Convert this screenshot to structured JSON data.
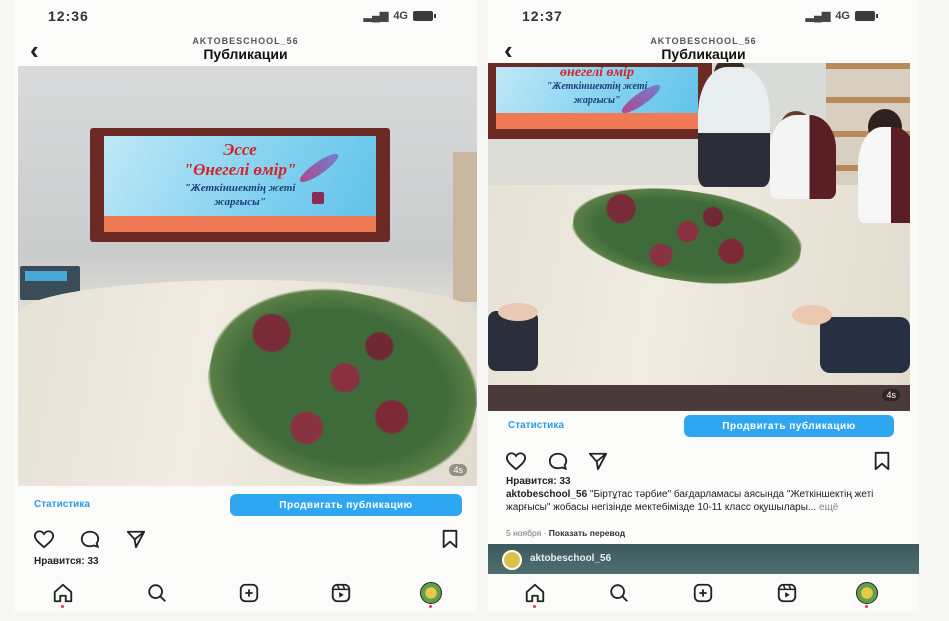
{
  "left": {
    "status": {
      "time": "12:36",
      "signal": "4G"
    },
    "nav": {
      "account": "AKTOBESCHOOL_56",
      "title": "Публикации"
    },
    "slide": {
      "line1": "Эссе",
      "line2": "\"Өнегелі өмір\"",
      "line3": "\"Жеткіншектің жеті",
      "line4": "жарғысы\""
    },
    "photo_counter": "4s",
    "stats_label": "Статистика",
    "promote_label": "Продвигать публикацию",
    "likes": "Нравится: 33",
    "overflow_text": "..."
  },
  "right": {
    "status": {
      "time": "12:37",
      "signal": "4G"
    },
    "nav": {
      "account": "AKTOBESCHOOL_56",
      "title": "Публикации"
    },
    "slide": {
      "line1": "өнегелі өмір",
      "line2": "\"Жеткіншектің жеті",
      "line3": "жарғысы\""
    },
    "photo_counter": "4s",
    "stats_label": "Статистика",
    "promote_label": "Продвигать публикацию",
    "likes": "Нравится: 33",
    "caption": {
      "user": "aktobeschool_56",
      "text": " \"Біртұтас тәрбие\" бағдарламасы аясында \"Жеткіншектің жеті жарғысы\" жобасы негізінде мектебімізде 10-11 класс оқушылары...",
      "more": " ещё"
    },
    "meta": {
      "date": "5 ноября",
      "separator": " · ",
      "translate": "Показать перевод"
    },
    "next_post_user": "aktobeschool_56"
  },
  "colors": {
    "accent": "#2fa6f0",
    "link": "#2a9ee8",
    "slide_red": "#d2232a"
  },
  "icons": {
    "actions": [
      "heart-icon",
      "comment-icon",
      "share-icon",
      "bookmark-icon"
    ],
    "tabs": [
      "home-icon",
      "search-icon",
      "create-icon",
      "reels-icon",
      "profile-avatar"
    ]
  }
}
